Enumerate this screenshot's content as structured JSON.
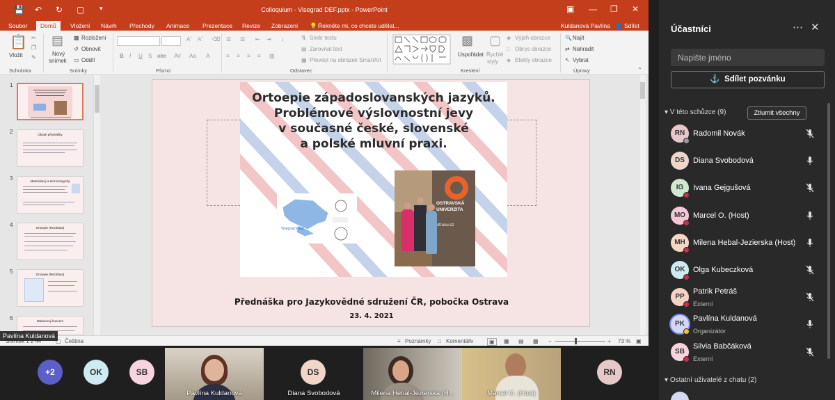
{
  "ppt": {
    "title": "Colloquium - Visegrad DEF.pptx - PowerPoint",
    "user": "Kuldanová Pavlína",
    "share": "Sdílet",
    "tabs": [
      "Soubor",
      "Domů",
      "Vložení",
      "Návrh",
      "Přechody",
      "Animace",
      "Prezentace",
      "Revize",
      "Zobrazení"
    ],
    "tell_me": "Řekněte mi, co chcete udělat...",
    "ribbon": {
      "paste": "Vložit",
      "new_slide_1": "Nový",
      "new_slide_2": "snímek",
      "layout": "Rozložení",
      "reset": "Obnovit",
      "section": "Oddíl",
      "groups": [
        "Schránka",
        "Snímky",
        "Písmo",
        "Odstavec",
        "Kreslení",
        "Úpravy"
      ],
      "text_direction": "Směr textu",
      "align_text": "Zarovnat text",
      "smartart": "Převést na obrázek SmartArt",
      "arrange": "Uspořádat",
      "quick_styles_1": "Rychlé",
      "quick_styles_2": "styly",
      "shape_fill": "Výplň obrazce",
      "shape_outline": "Obrys obrazce",
      "shape_effects": "Efekty obrazce",
      "find": "Najít",
      "replace": "Nahradit",
      "select": "Vybrat"
    },
    "slide": {
      "heading": [
        "Ortoepie západoslovanských jazyků.",
        "Problémové výslovnostní jevy",
        "v současné české, slovenské",
        "a polské mluvní praxi."
      ],
      "map_label": "Visegrad Fund",
      "photo_sign_1": "OSTRAVSKÁ",
      "photo_sign_2": "UNIVERZITA",
      "photo_web": "pdf.osu.cz",
      "subtitle": "Přednáška pro Jazykovědné sdružení ČR, pobočka Ostrava",
      "date": "23. 4. 2021"
    },
    "thumb_numbers": [
      "1",
      "2",
      "3",
      "4",
      "5",
      "6"
    ],
    "thumb_titles": [
      "",
      "Obsah přednášky",
      "Materiálový a terminologický",
      "Ortoepie (Rechtlaut)",
      "Ortoepie (Rechtlaut)",
      "Markerový koncern"
    ],
    "status": {
      "slide": "Snímek 1 z 44",
      "language": "Čeština",
      "notes": "Poznámky",
      "comments": "Komentáře",
      "zoom": "73 %"
    }
  },
  "participants": {
    "title": "Účastníci",
    "search_placeholder": "Napište jméno",
    "share_invite": "Sdílet pozvánku",
    "in_meeting": "V této schůzce (9)",
    "mute_all": "Ztlumit všechny",
    "others": "Ostatní uživatelé z chatu (2)",
    "people": [
      {
        "initials": "RN",
        "name": "Radomil Novák",
        "role": "",
        "muted": true,
        "color": "#e7c8c8",
        "dot": "#9a9a9a"
      },
      {
        "initials": "DS",
        "name": "Diana Svobodová",
        "role": "",
        "muted": false,
        "color": "#f0d6c8",
        "dot": ""
      },
      {
        "initials": "IG",
        "name": "Ivana Gejgušová",
        "role": "",
        "muted": true,
        "color": "#cfe8d0",
        "dot": "#c4314b"
      },
      {
        "initials": "MO",
        "name": "Marcel O. (Host)",
        "role": "",
        "muted": false,
        "color": "#f3c7d8",
        "dot": "#c4314b"
      },
      {
        "initials": "MH",
        "name": "Milena Hebal-Jezierska (Host)",
        "role": "",
        "muted": false,
        "color": "#f6d7c2",
        "dot": "#c4314b"
      },
      {
        "initials": "OK",
        "name": "Olga Kubeczková",
        "role": "",
        "muted": true,
        "color": "#cdebf0",
        "dot": "#c4314b"
      },
      {
        "initials": "PP",
        "name": "Patrik Petráš",
        "role": "Externí",
        "muted": true,
        "color": "#f6d2c4",
        "dot": "#c4314b"
      },
      {
        "initials": "PK",
        "name": "Pavlína Kuldanová",
        "role": "Organizátor",
        "muted": false,
        "color": "#d5d8f3",
        "dot": "#f8c12b"
      },
      {
        "initials": "SB",
        "name": "Silvia Babčáková",
        "role": "Externí",
        "muted": true,
        "color": "#f7d4de",
        "dot": "#c4314b"
      }
    ]
  },
  "strip": {
    "overflow": "+2",
    "avatars": [
      "OK",
      "SB",
      "DS",
      "RN"
    ],
    "videos": [
      "Pavlína Kuldanová",
      "Diana Svobodová",
      "Milena Hebal-Jezierska (H...",
      "Marcel O. (Host)"
    ],
    "presenter": "Pavlína Kuldanová"
  },
  "colors": {
    "accent": "#c43e1c",
    "teams_bg": "#292929",
    "muted_dot": "#c4314b",
    "overflow_avatar": "#5b5fc7"
  }
}
